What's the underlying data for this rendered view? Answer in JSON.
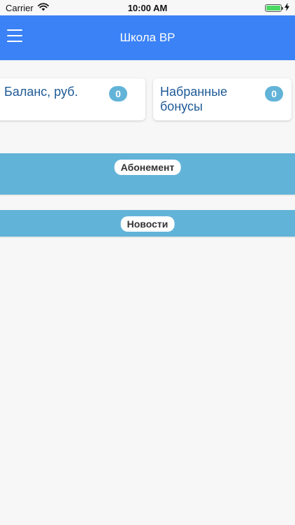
{
  "status_bar": {
    "carrier": "Carrier",
    "time": "10:00 AM",
    "wifi_icon": "wifi-icon",
    "battery_icon": "battery-icon",
    "charging_icon": "charging-bolt-icon"
  },
  "nav": {
    "title": "Школа ВР",
    "menu_icon": "hamburger-menu-icon",
    "color": "#3b82f6"
  },
  "cards": {
    "balance": {
      "label": "Баланс, руб.",
      "value": "0"
    },
    "bonuses": {
      "label": "Набранные бонусы",
      "value": "0"
    }
  },
  "sections": {
    "subscription": "Абонемент",
    "news": "Новости"
  },
  "colors": {
    "accent": "#62b3d8",
    "card_text": "#1e5a96",
    "background": "#f7f7f7"
  }
}
